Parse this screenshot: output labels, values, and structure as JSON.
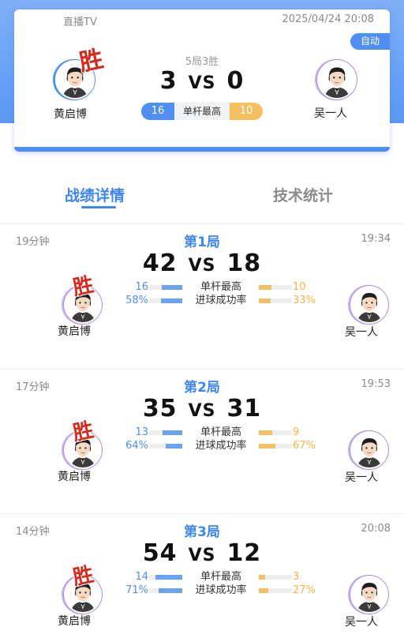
{
  "header": {
    "source": "直播TV",
    "datetime": "2025/04/24 20:08",
    "auto_label": "自动",
    "format": "5局3胜",
    "score_left": "3",
    "vs": "VS",
    "score_right": "0",
    "highest_break_label": "单杆最高",
    "highest_break_left": "16",
    "highest_break_right": "10",
    "win_label": "胜"
  },
  "players": {
    "left": "黄启博",
    "right": "吴一人"
  },
  "tabs": [
    {
      "label": "战绩详情",
      "active": true
    },
    {
      "label": "技术统计",
      "active": false
    }
  ],
  "colors": {
    "accent_blue": "#4f8ff2",
    "accent_orange": "#f3c063",
    "win_red": "#d42b1e"
  },
  "games": [
    {
      "duration": "19分钟",
      "title": "第1局",
      "end_time": "19:34",
      "score_left": "42",
      "vs": "VS",
      "score_right": "18",
      "win_label": "胜",
      "player_left": "黄启博",
      "player_right": "吴一人",
      "stats": [
        {
          "label": "单杆最高",
          "left": "16",
          "right": "10",
          "left_frac": 0.62,
          "right_frac": 0.38
        },
        {
          "label": "进球成功率",
          "left": "58%",
          "right": "33%",
          "left_frac": 0.64,
          "right_frac": 0.36
        }
      ]
    },
    {
      "duration": "17分钟",
      "title": "第2局",
      "end_time": "19:53",
      "score_left": "35",
      "vs": "VS",
      "score_right": "31",
      "win_label": "胜",
      "player_left": "黄启博",
      "player_right": "吴一人",
      "stats": [
        {
          "label": "单杆最高",
          "left": "13",
          "right": "9",
          "left_frac": 0.59,
          "right_frac": 0.41
        },
        {
          "label": "进球成功率",
          "left": "64%",
          "right": "67%",
          "left_frac": 0.49,
          "right_frac": 0.51
        }
      ]
    },
    {
      "duration": "14分钟",
      "title": "第3局",
      "end_time": "20:08",
      "score_left": "54",
      "vs": "VS",
      "score_right": "12",
      "win_label": "胜",
      "player_left": "黄启博",
      "player_right": "吴一人",
      "stats": [
        {
          "label": "单杆最高",
          "left": "14",
          "right": "3",
          "left_frac": 0.82,
          "right_frac": 0.18
        },
        {
          "label": "进球成功率",
          "left": "71%",
          "right": "27%",
          "left_frac": 0.72,
          "right_frac": 0.28
        }
      ]
    }
  ]
}
